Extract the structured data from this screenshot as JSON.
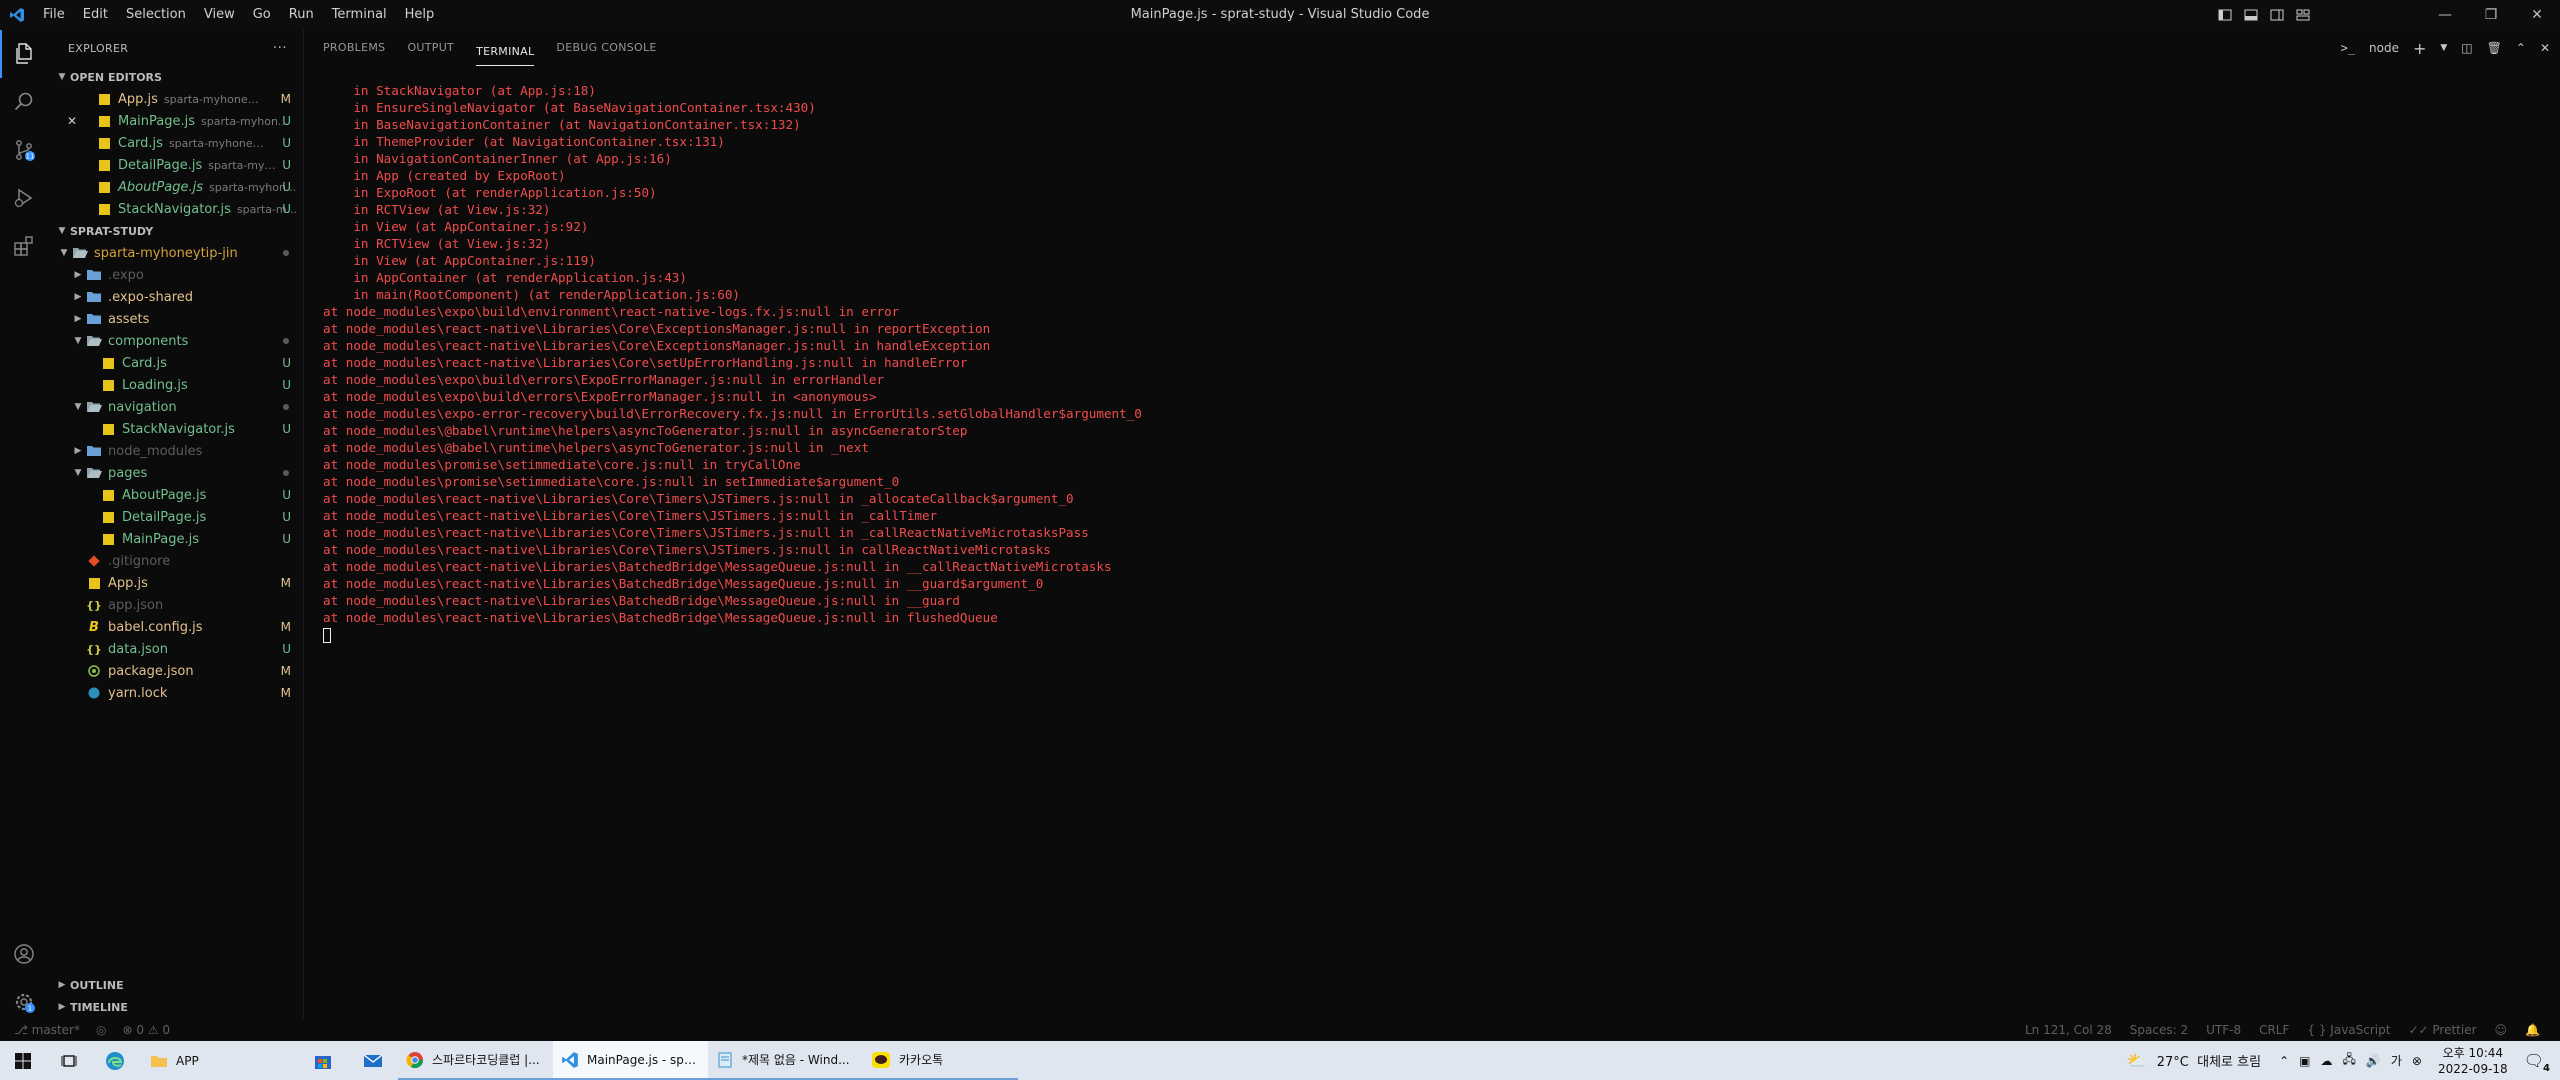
{
  "window": {
    "title": "MainPage.js - sprat-study - Visual Studio Code",
    "menu": [
      "File",
      "Edit",
      "Selection",
      "View",
      "Go",
      "Run",
      "Terminal",
      "Help"
    ]
  },
  "sidebar": {
    "title": "EXPLORER",
    "open_editors_label": "OPEN EDITORS",
    "open_editors": [
      {
        "name": "App.js",
        "path": "sparta-myhoneytip-jin",
        "badge": "M",
        "italic": false,
        "close": false
      },
      {
        "name": "MainPage.js",
        "path": "sparta-myhon...",
        "badge": "U",
        "italic": false,
        "close": true
      },
      {
        "name": "Card.js",
        "path": "sparta-myhoneytip-j...",
        "badge": "U",
        "italic": false,
        "close": false
      },
      {
        "name": "DetailPage.js",
        "path": "sparta-myhon...",
        "badge": "U",
        "italic": false,
        "close": false
      },
      {
        "name": "AboutPage.js",
        "path": "sparta-myhon...",
        "badge": "U",
        "italic": true,
        "close": false
      },
      {
        "name": "StackNavigator.js",
        "path": "sparta-m...",
        "badge": "U",
        "italic": false,
        "close": false
      }
    ],
    "workspace_label": "SPRAT-STUDY",
    "tree": [
      {
        "name": "sparta-myhoneytip-jin",
        "type": "folder-open",
        "depth": 1,
        "badge": "",
        "color": "cM",
        "dot": true
      },
      {
        "name": ".expo",
        "type": "folder",
        "depth": 2,
        "badge": "",
        "color": "cDim",
        "dot": false
      },
      {
        "name": ".expo-shared",
        "type": "folder",
        "depth": 2,
        "badge": "",
        "color": "cMod",
        "dot": false
      },
      {
        "name": "assets",
        "type": "folder",
        "depth": 2,
        "badge": "",
        "color": "cMod",
        "dot": false
      },
      {
        "name": "components",
        "type": "folder-open",
        "depth": 2,
        "badge": "",
        "color": "cUnt",
        "dot": true
      },
      {
        "name": "Card.js",
        "type": "js",
        "depth": 3,
        "badge": "U",
        "color": "cUnt",
        "dot": false
      },
      {
        "name": "Loading.js",
        "type": "js",
        "depth": 3,
        "badge": "U",
        "color": "cUnt",
        "dot": false
      },
      {
        "name": "navigation",
        "type": "folder-open",
        "depth": 2,
        "badge": "",
        "color": "cUnt",
        "dot": true
      },
      {
        "name": "StackNavigator.js",
        "type": "js",
        "depth": 3,
        "badge": "U",
        "color": "cUnt",
        "dot": false
      },
      {
        "name": "node_modules",
        "type": "folder",
        "depth": 2,
        "badge": "",
        "color": "cDim",
        "dot": false
      },
      {
        "name": "pages",
        "type": "folder-open",
        "depth": 2,
        "badge": "",
        "color": "cUnt",
        "dot": true
      },
      {
        "name": "AboutPage.js",
        "type": "js",
        "depth": 3,
        "badge": "U",
        "color": "cUnt",
        "dot": false
      },
      {
        "name": "DetailPage.js",
        "type": "js",
        "depth": 3,
        "badge": "U",
        "color": "cUnt",
        "dot": false
      },
      {
        "name": "MainPage.js",
        "type": "js",
        "depth": 3,
        "badge": "U",
        "color": "cUnt",
        "dot": false
      },
      {
        "name": ".gitignore",
        "type": "git",
        "depth": 2,
        "badge": "",
        "color": "cDim",
        "dot": false
      },
      {
        "name": "App.js",
        "type": "js",
        "depth": 2,
        "badge": "M",
        "color": "cMod",
        "dot": false
      },
      {
        "name": "app.json",
        "type": "json",
        "depth": 2,
        "badge": "",
        "color": "cDim",
        "dot": false
      },
      {
        "name": "babel.config.js",
        "type": "babel",
        "depth": 2,
        "badge": "M",
        "color": "cMod",
        "dot": false
      },
      {
        "name": "data.json",
        "type": "json",
        "depth": 2,
        "badge": "U",
        "color": "cUnt",
        "dot": false
      },
      {
        "name": "package.json",
        "type": "npm",
        "depth": 2,
        "badge": "M",
        "color": "cMod",
        "dot": false
      },
      {
        "name": "yarn.lock",
        "type": "yarn",
        "depth": 2,
        "badge": "M",
        "color": "cMod",
        "dot": false
      }
    ],
    "outline_label": "OUTLINE",
    "timeline_label": "TIMELINE"
  },
  "panel": {
    "tabs": [
      "PROBLEMS",
      "OUTPUT",
      "TERMINAL",
      "DEBUG CONSOLE"
    ],
    "active_tab": "TERMINAL",
    "terminal_name": "node",
    "terminal_lines": [
      "    in StackNavigator (at App.js:18)",
      "    in EnsureSingleNavigator (at BaseNavigationContainer.tsx:430)",
      "    in BaseNavigationContainer (at NavigationContainer.tsx:132)",
      "    in ThemeProvider (at NavigationContainer.tsx:131)",
      "    in NavigationContainerInner (at App.js:16)",
      "    in App (created by ExpoRoot)",
      "    in ExpoRoot (at renderApplication.js:50)",
      "    in RCTView (at View.js:32)",
      "    in View (at AppContainer.js:92)",
      "    in RCTView (at View.js:32)",
      "    in View (at AppContainer.js:119)",
      "    in AppContainer (at renderApplication.js:43)",
      "    in main(RootComponent) (at renderApplication.js:60)",
      "at node_modules\\expo\\build\\environment\\react-native-logs.fx.js:null in error",
      "at node_modules\\react-native\\Libraries\\Core\\ExceptionsManager.js:null in reportException",
      "at node_modules\\react-native\\Libraries\\Core\\ExceptionsManager.js:null in handleException",
      "at node_modules\\react-native\\Libraries\\Core\\setUpErrorHandling.js:null in handleError",
      "at node_modules\\expo\\build\\errors\\ExpoErrorManager.js:null in errorHandler",
      "at node_modules\\expo\\build\\errors\\ExpoErrorManager.js:null in <anonymous>",
      "at node_modules\\expo-error-recovery\\build\\ErrorRecovery.fx.js:null in ErrorUtils.setGlobalHandler$argument_0",
      "at node_modules\\@babel\\runtime\\helpers\\asyncToGenerator.js:null in asyncGeneratorStep",
      "at node_modules\\@babel\\runtime\\helpers\\asyncToGenerator.js:null in _next",
      "at node_modules\\promise\\setimmediate\\core.js:null in tryCallOne",
      "at node_modules\\promise\\setimmediate\\core.js:null in setImmediate$argument_0",
      "at node_modules\\react-native\\Libraries\\Core\\Timers\\JSTimers.js:null in _allocateCallback$argument_0",
      "at node_modules\\react-native\\Libraries\\Core\\Timers\\JSTimers.js:null in _callTimer",
      "at node_modules\\react-native\\Libraries\\Core\\Timers\\JSTimers.js:null in _callReactNativeMicrotasksPass",
      "at node_modules\\react-native\\Libraries\\Core\\Timers\\JSTimers.js:null in callReactNativeMicrotasks",
      "at node_modules\\react-native\\Libraries\\BatchedBridge\\MessageQueue.js:null in __callReactNativeMicrotasks",
      "at node_modules\\react-native\\Libraries\\BatchedBridge\\MessageQueue.js:null in __guard$argument_0",
      "at node_modules\\react-native\\Libraries\\BatchedBridge\\MessageQueue.js:null in __guard",
      "at node_modules\\react-native\\Libraries\\BatchedBridge\\MessageQueue.js:null in flushedQueue"
    ]
  },
  "statusbar": {
    "branch": "master*",
    "errors": "0",
    "warnings": "0",
    "position": "Ln 121, Col 28",
    "spaces": "Spaces: 2",
    "encoding": "UTF-8",
    "eol": "CRLF",
    "language": "JavaScript",
    "formatter": "Prettier"
  },
  "taskbar": {
    "apps": [
      {
        "label": "스파르타코딩클럽 |...",
        "icon": "chrome",
        "active": false
      },
      {
        "label": "MainPage.js - sprat...",
        "icon": "vscode",
        "active": true
      },
      {
        "label": "*제목 없음 - Wind...",
        "icon": "notepad",
        "active": false
      },
      {
        "label": "카카오톡",
        "icon": "kakao",
        "active": false
      }
    ],
    "folder_label": "APP",
    "weather": "27°C  대체로 흐림",
    "time": "오후 10:44",
    "date": "2022-09-18",
    "notifications": "4"
  },
  "colors": {
    "terminal_error": "#f14c4c",
    "accent": "#3794ff",
    "modified": "#e2c08d",
    "untracked": "#73c991"
  }
}
